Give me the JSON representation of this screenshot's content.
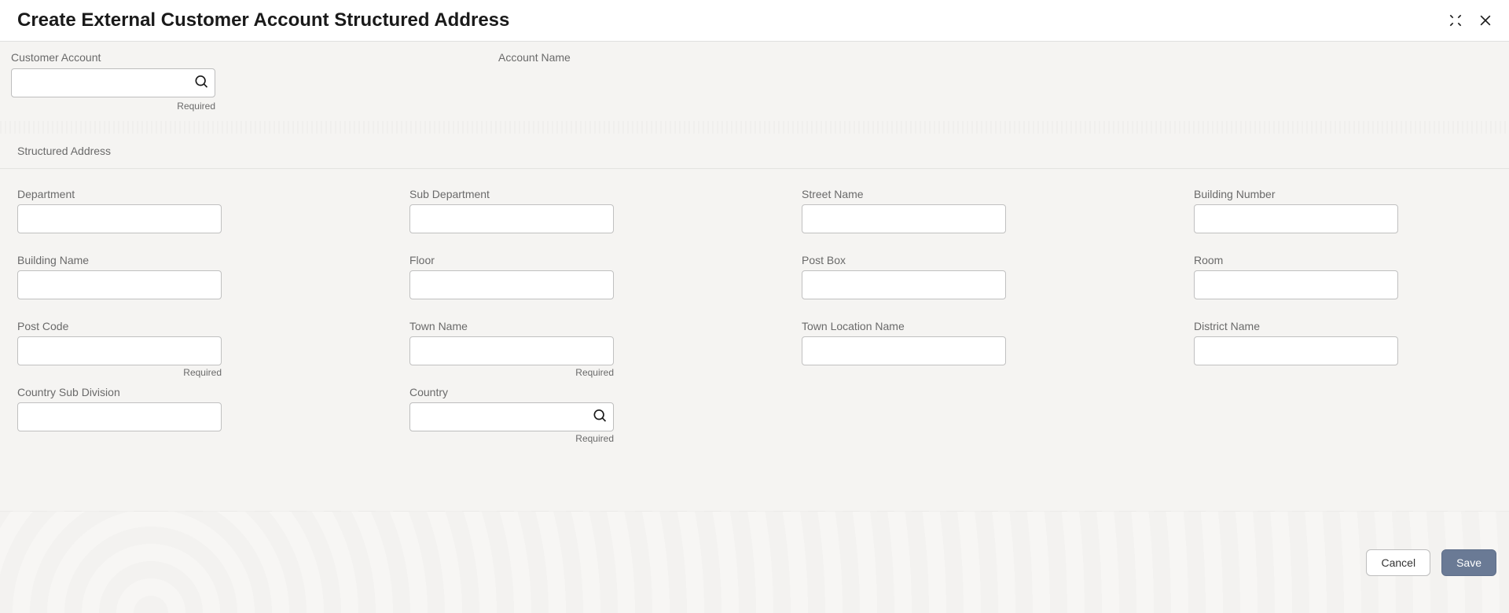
{
  "header": {
    "title": "Create External Customer Account Structured Address"
  },
  "topSection": {
    "customerAccount": {
      "label": "Customer Account",
      "value": "",
      "required": "Required"
    },
    "accountName": {
      "label": "Account Name",
      "value": ""
    }
  },
  "sectionHeading": "Structured Address",
  "fields": {
    "department": {
      "label": "Department",
      "value": ""
    },
    "subDepartment": {
      "label": "Sub Department",
      "value": ""
    },
    "streetName": {
      "label": "Street Name",
      "value": ""
    },
    "buildingNumber": {
      "label": "Building Number",
      "value": ""
    },
    "buildingName": {
      "label": "Building Name",
      "value": ""
    },
    "floor": {
      "label": "Floor",
      "value": ""
    },
    "postBox": {
      "label": "Post Box",
      "value": ""
    },
    "room": {
      "label": "Room",
      "value": ""
    },
    "postCode": {
      "label": "Post Code",
      "value": "",
      "required": "Required"
    },
    "townName": {
      "label": "Town Name",
      "value": "",
      "required": "Required"
    },
    "townLocationName": {
      "label": "Town Location Name",
      "value": ""
    },
    "districtName": {
      "label": "District Name",
      "value": ""
    },
    "countrySubDivision": {
      "label": "Country Sub Division",
      "value": ""
    },
    "country": {
      "label": "Country",
      "value": "",
      "required": "Required"
    }
  },
  "footer": {
    "cancel": "Cancel",
    "save": "Save"
  }
}
